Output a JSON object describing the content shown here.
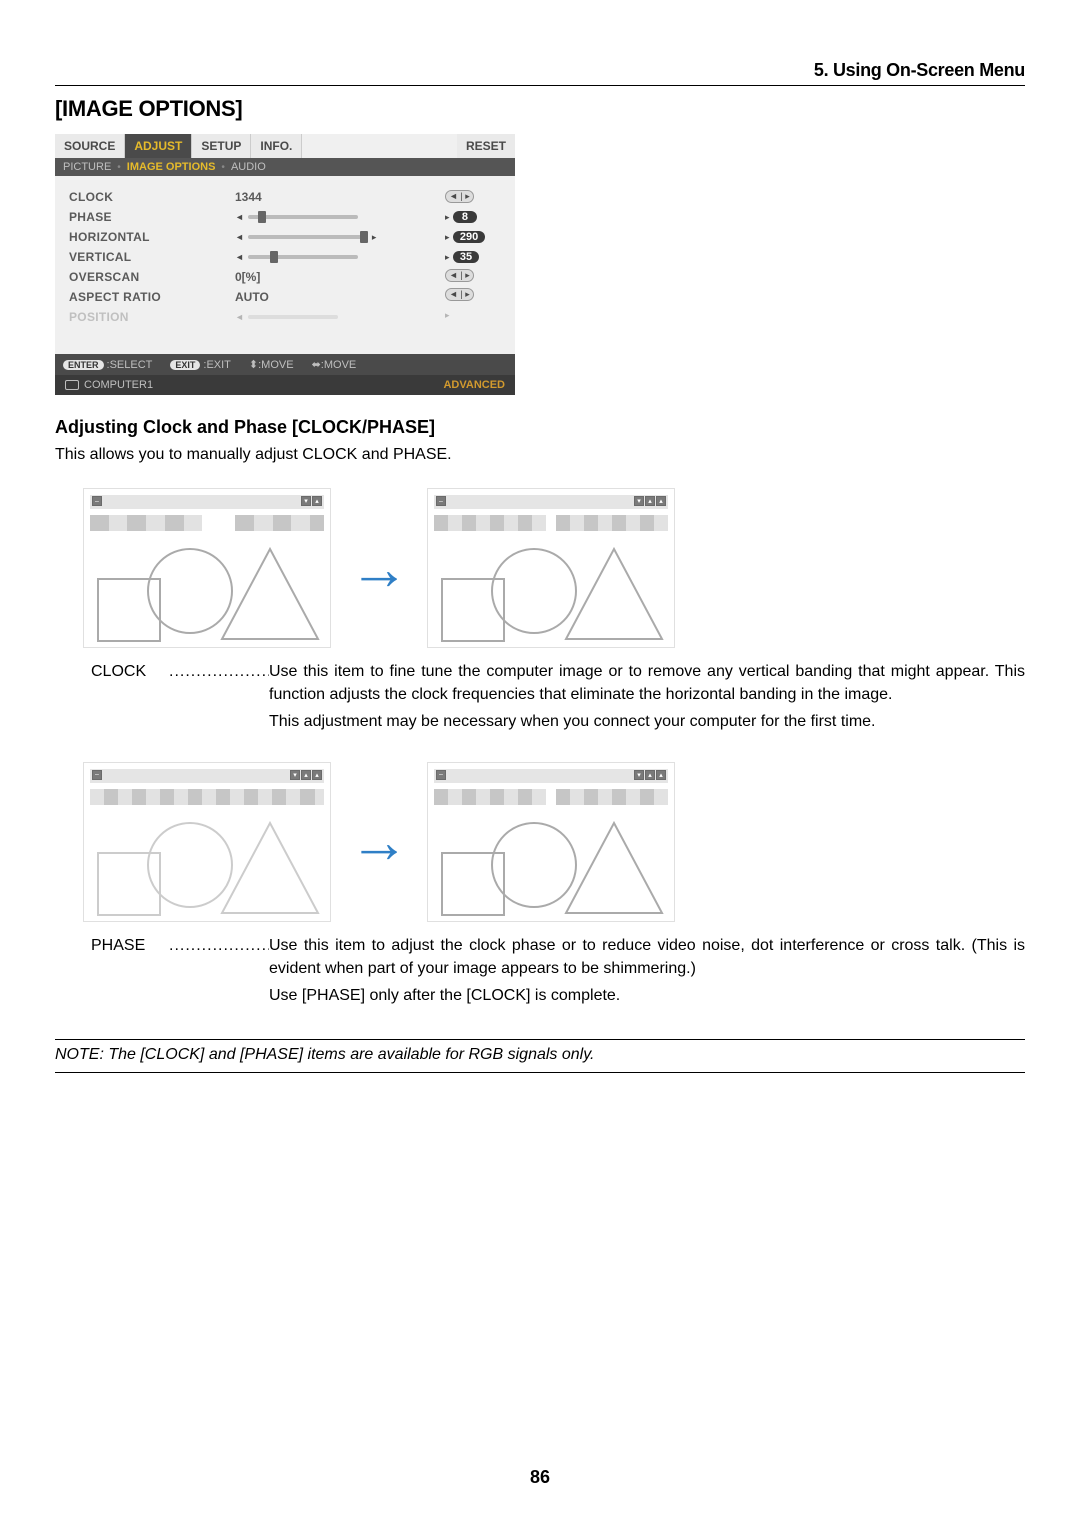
{
  "chapter": "5. Using On-Screen Menu",
  "section_title": "[IMAGE OPTIONS]",
  "osd": {
    "tabs": [
      "SOURCE",
      "ADJUST",
      "SETUP",
      "INFO.",
      "RESET"
    ],
    "active_tab": "ADJUST",
    "subtabs": [
      "PICTURE",
      "IMAGE OPTIONS",
      "AUDIO"
    ],
    "active_subtab": "IMAGE OPTIONS",
    "items": [
      {
        "label": "CLOCK",
        "value": "1344",
        "right_type": "arrows"
      },
      {
        "label": "PHASE",
        "value_type": "slider",
        "right_value": "8"
      },
      {
        "label": "HORIZONTAL",
        "value_type": "slider",
        "right_value": "290"
      },
      {
        "label": "VERTICAL",
        "value_type": "slider",
        "right_value": "35"
      },
      {
        "label": "OVERSCAN",
        "value": "0[%]",
        "right_type": "arrows"
      },
      {
        "label": "ASPECT RATIO",
        "value": "AUTO",
        "right_type": "arrows"
      },
      {
        "label": "POSITION",
        "disabled": true
      }
    ],
    "footer": {
      "enter": "ENTER",
      "enter_label": ":SELECT",
      "exit": "EXIT",
      "exit_label": ":EXIT",
      "move_ud": ":MOVE",
      "move_lr": ":MOVE"
    },
    "footer2": {
      "source": "COMPUTER1",
      "mode": "ADVANCED"
    }
  },
  "subhead": "Adjusting Clock and Phase [CLOCK/PHASE]",
  "intro": "This allows you to manually adjust CLOCK and PHASE.",
  "defs": {
    "clock": {
      "term": "CLOCK",
      "lines": [
        "Use this item to fine tune the computer image or to remove any vertical banding that might appear. This function adjusts the clock frequencies that eliminate the horizontal banding in the image.",
        "This adjustment may be necessary when you connect your computer for the first time."
      ]
    },
    "phase": {
      "term": "PHASE",
      "lines": [
        "Use this item to adjust the clock phase or to reduce video noise, dot interference or cross talk. (This is evident when part of your image appears to be shimmering.)",
        "Use [PHASE] only after the [CLOCK] is complete."
      ]
    }
  },
  "note": "NOTE: The [CLOCK] and [PHASE] items are available for RGB signals only.",
  "page_number": "86"
}
